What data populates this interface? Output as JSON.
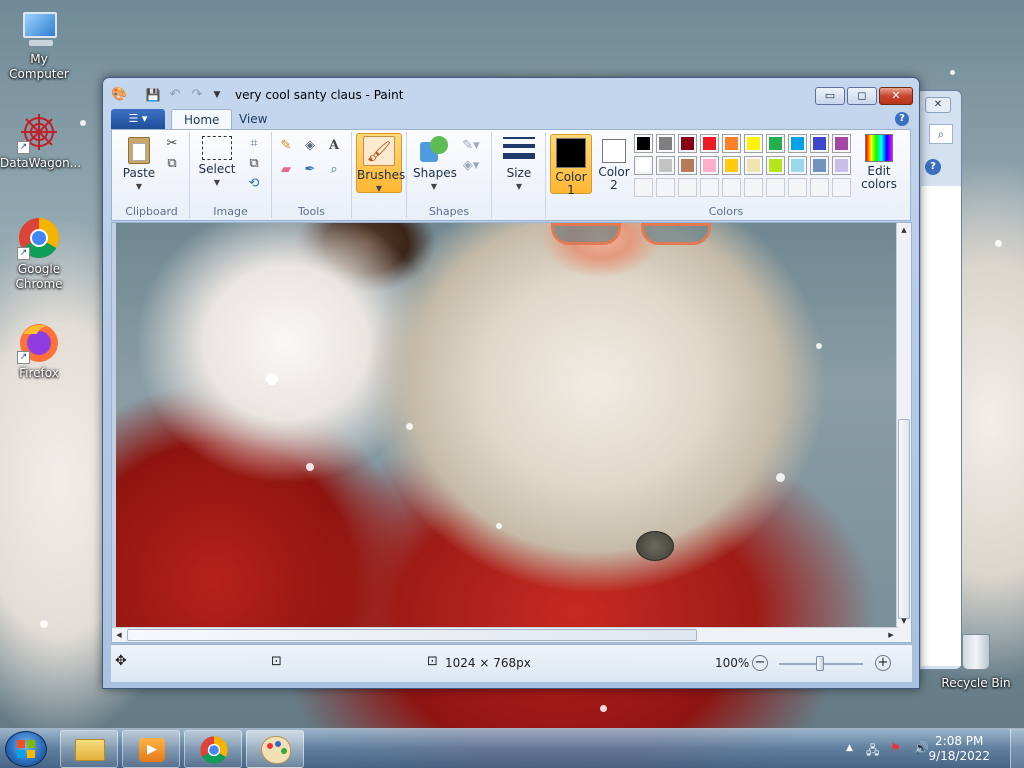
{
  "desktop": {
    "icons": [
      {
        "label": "My Computer"
      },
      {
        "label": "DataWagon..."
      },
      {
        "label": "Google Chrome"
      },
      {
        "label": "Firefox"
      },
      {
        "label": "Recycle Bin"
      }
    ]
  },
  "window": {
    "title": "very cool santy claus - Paint",
    "caption": {
      "minimize": "▭",
      "maximize": "◻",
      "close": "✕"
    }
  },
  "ribbon": {
    "tabs": [
      "Home",
      "View"
    ],
    "groups": {
      "clipboard": {
        "label": "Clipboard",
        "paste": "Paste"
      },
      "image": {
        "label": "Image",
        "select": "Select"
      },
      "tools": {
        "label": "Tools"
      },
      "brushes": {
        "label": "Brushes"
      },
      "shapes": {
        "label": "Shapes",
        "shapes_btn": "Shapes"
      },
      "size": {
        "label": "Size"
      },
      "colors": {
        "label": "Colors",
        "color1_a": "Color",
        "color1_b": "1",
        "color2_a": "Color",
        "color2_b": "2",
        "edit_a": "Edit",
        "edit_b": "colors",
        "color1": "#000000",
        "color2": "#ffffff",
        "palette_row1": [
          "#000000",
          "#7f7f7f",
          "#880015",
          "#ed1c24",
          "#ff7f27",
          "#fff200",
          "#22b14c",
          "#00a2e8",
          "#3f48cc",
          "#a349a4"
        ],
        "palette_row2": [
          "#ffffff",
          "#c3c3c3",
          "#b97a57",
          "#ffaec9",
          "#ffc90e",
          "#efe4b0",
          "#b5e61d",
          "#99d9ea",
          "#7092be",
          "#c8bfe7"
        ]
      }
    }
  },
  "statusbar": {
    "dimensions": "1024 × 768px",
    "zoom": "100%"
  },
  "taskbar": {
    "time": "2:08 PM",
    "date": "9/18/2022"
  }
}
